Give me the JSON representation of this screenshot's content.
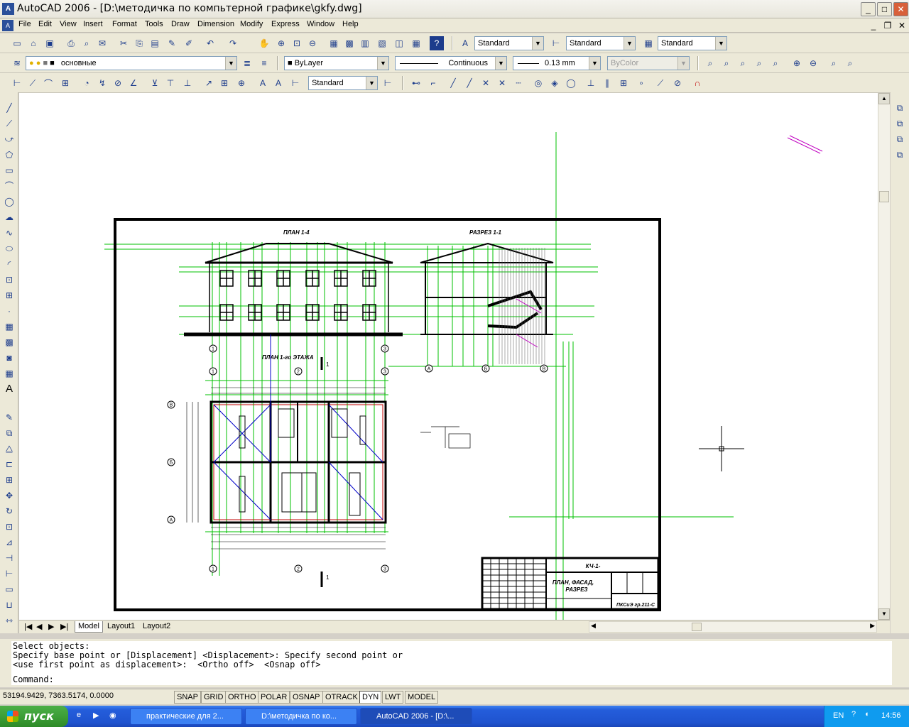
{
  "window": {
    "title": "AutoCAD 2006 - [D:\\методичка по компьтерной графике\\gkfy.dwg]"
  },
  "menu": [
    "File",
    "Edit",
    "View",
    "Insert",
    "Format",
    "Tools",
    "Draw",
    "Dimension",
    "Modify",
    "Express",
    "Window",
    "Help"
  ],
  "styles": {
    "text_style": "Standard",
    "dim_style": "Standard",
    "table_style": "Standard",
    "dim_style_2": "Standard"
  },
  "layers": {
    "current_layer": "основные",
    "color": "ByLayer",
    "linetype": "Continuous",
    "lineweight": "0.13 mm",
    "plotstyle": "ByColor"
  },
  "drawing": {
    "plan_title": "ПЛАН 1-4",
    "section_title": "РАЗРЕЗ 1-1",
    "floor_plan_title": "ПЛАН 1-го ЭТАЖА",
    "stamp_code": "КЧ-1-",
    "stamp_name_1": "ПЛАН, ФАСАД,",
    "stamp_name_2": "РАЗРЕЗ",
    "stamp_group": "ПКСиЭ гр.211-С",
    "axis_labels": [
      "1",
      "2",
      "3",
      "А",
      "Б",
      "В"
    ],
    "cut_mark": "1"
  },
  "tabs": [
    "Model",
    "Layout1",
    "Layout2"
  ],
  "command": {
    "history": [
      "Select objects:",
      "Specify base point or [Displacement] <Displacement>: Specify second point or",
      "<use first point as displacement>:  <Ortho off>  <Osnap off>"
    ],
    "prompt": "Command:"
  },
  "status": {
    "coords": "53194.9429, 7363.5174, 0.0000",
    "toggles": [
      "SNAP",
      "GRID",
      "ORTHO",
      "POLAR",
      "OSNAP",
      "OTRACK",
      "DYN",
      "LWT",
      "MODEL"
    ]
  },
  "taskbar": {
    "start": "пуск",
    "items": [
      "практические для 2...",
      "D:\\методичка по ко...",
      "AutoCAD 2006 - [D:\\..."
    ],
    "lang": "EN",
    "time": "14:56"
  },
  "colors": {
    "accent_green": "#00c000",
    "frame": "#000000",
    "blue_line": "#0000c8",
    "red_line": "#c00000",
    "magenta": "#c000c0"
  }
}
